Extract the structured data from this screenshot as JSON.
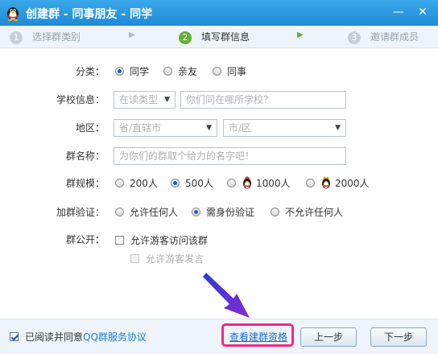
{
  "window": {
    "title": "创建群 - 同事朋友 - 同学",
    "minimize": "—",
    "close": "✕"
  },
  "steps": [
    {
      "num": "1",
      "label": "选择群类别",
      "state": "done"
    },
    {
      "num": "2",
      "label": "填写群信息",
      "state": "active"
    },
    {
      "num": "3",
      "label": "邀请群成员",
      "state": "pending"
    }
  ],
  "form": {
    "category": {
      "label": "分类：",
      "options": [
        "同学",
        "亲友",
        "同事"
      ],
      "selected": "同学"
    },
    "school": {
      "label": "学校信息：",
      "type_select": "在读类型",
      "school_placeholder": "你们同在哪所学校？"
    },
    "region": {
      "label": "地区：",
      "province_placeholder": "省/直辖市",
      "city_placeholder": "市/区"
    },
    "name": {
      "label": "群名称：",
      "placeholder": "为你们的群取个给力的名字吧！"
    },
    "size": {
      "label": "群规模：",
      "options": [
        "200人",
        "500人",
        "1000人",
        "2000人"
      ],
      "selected": "500人"
    },
    "verify": {
      "label": "加群验证：",
      "options": [
        "允许任何人",
        "需身份验证",
        "不允许任何人"
      ],
      "selected": "需身份验证"
    },
    "public": {
      "label": "群公开：",
      "allow_visit": "允许游客访问该群",
      "allow_visit_checked": false,
      "allow_post": "允许游客发言",
      "allow_post_enabled": false
    }
  },
  "footer": {
    "agree_text": "已阅读并同意",
    "agree_link": "QQ群服务协议",
    "agree_checked": true,
    "view_qualification": "查看建群资格",
    "prev": "上一步",
    "next": "下一步"
  },
  "colors": {
    "titlebar": "#2a98e0",
    "step_active": "#5fb333",
    "link": "#1c6dd0",
    "highlight": "#ea2a88",
    "annotation_arrow": "#2f2fcf"
  }
}
